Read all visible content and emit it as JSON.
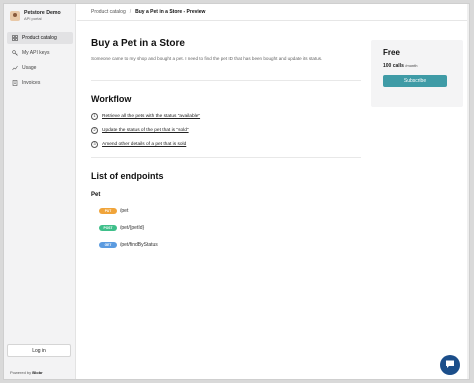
{
  "sidebar": {
    "brand_name": "Petstore Demo",
    "brand_sub": "API portal",
    "items": [
      {
        "label": "Product catalog",
        "icon": "catalog-icon",
        "active": true
      },
      {
        "label": "My API keys",
        "icon": "key-icon",
        "active": false
      },
      {
        "label": "Usage",
        "icon": "usage-chart-icon",
        "active": false
      },
      {
        "label": "Invoices",
        "icon": "invoice-icon",
        "active": false
      }
    ],
    "login_label": "Log in",
    "powered_prefix": "Powered by",
    "powered_brand": "Blobr"
  },
  "breadcrumb": {
    "parent": "Product catalog",
    "separator": "/",
    "current": "Buy a Pet in a Store - Preview"
  },
  "main": {
    "title": "Buy a Pet in a Store",
    "description": "Someone came to my shop and bought a pet. I need to find the pet ID that has been bought and update its status.",
    "workflow_title": "Workflow",
    "steps": [
      {
        "num": "1",
        "label": "Retrieve all the pets with the status \"available\""
      },
      {
        "num": "2",
        "label": "Update the status of the pet that is \"sold\""
      },
      {
        "num": "3",
        "label": "Amend other details of a pet that is sold"
      }
    ],
    "endpoints_title": "List of endpoints",
    "group_title": "Pet",
    "endpoints": [
      {
        "method": "PUT",
        "path": "/pet",
        "color": "#f0a43a"
      },
      {
        "method": "POST",
        "path": "/pet/{petId}",
        "color": "#3fbf8a"
      },
      {
        "method": "GET",
        "path": "/pet/findByStatus",
        "color": "#5b9be0"
      }
    ]
  },
  "plan": {
    "name": "Free",
    "calls": "100 calls",
    "period": "/month",
    "subscribe_label": "Subscribe",
    "accent": "#3f9ba6"
  },
  "chat": {
    "icon": "chat-icon",
    "color": "#1b4e8a"
  }
}
